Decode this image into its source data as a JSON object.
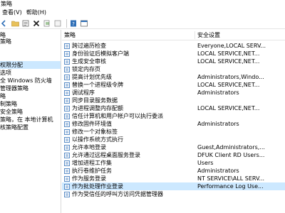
{
  "window": {
    "title": "策略"
  },
  "menubar": {
    "items": [
      "查看(V)",
      "帮助(H)"
    ]
  },
  "toolbar": {
    "icons": [
      "back-icon",
      "forward-icon",
      "folder-icon",
      "properties-icon",
      "delete-icon",
      "export-icon",
      "refresh-icon",
      "help-icon",
      "console-icon"
    ]
  },
  "tree": {
    "items": [
      {
        "label": "略"
      },
      {
        "label": "策略"
      },
      {
        "label": "权限分配"
      },
      {
        "label": "选项"
      },
      {
        "label": "全 Windows 防火墙"
      },
      {
        "label": "管理器策略"
      },
      {
        "label": "略"
      },
      {
        "label": "制策略"
      },
      {
        "label": "安全策略"
      },
      {
        "label": "策略，在 本地计算机"
      },
      {
        "label": "核策略配置"
      }
    ]
  },
  "table": {
    "columns": {
      "policy": "策略",
      "setting": "安全设置"
    },
    "rows": [
      {
        "policy": "跨过遍历检查",
        "setting": "Everyone,LOCAL SERV..."
      },
      {
        "policy": "身份验证后模拟客户端",
        "setting": "LOCAL SERVICE,NET..."
      },
      {
        "policy": "生成安全审核",
        "setting": "LOCAL SERVICE,NET..."
      },
      {
        "policy": "锁定内存页",
        "setting": ""
      },
      {
        "policy": "提高计划优先级",
        "setting": "Administrators,Windo..."
      },
      {
        "policy": "替换一个进程级令牌",
        "setting": "LOCAL SERVICE,NET..."
      },
      {
        "policy": "调试程序",
        "setting": "Administrators"
      },
      {
        "policy": "同步目录服务数据",
        "setting": ""
      },
      {
        "policy": "为进程调整内存配额",
        "setting": "LOCAL SERVICE,NET..."
      },
      {
        "policy": "信任计算机和用户帐户可以执行委派",
        "setting": ""
      },
      {
        "policy": "修改固件环境值",
        "setting": "Administrators"
      },
      {
        "policy": "修改一个对象标签",
        "setting": ""
      },
      {
        "policy": "以操作系统方式执行",
        "setting": ""
      },
      {
        "policy": "允许本地登录",
        "setting": "Guest,Administrators,..."
      },
      {
        "policy": "允许通过远程桌面服务登录",
        "setting": "DFUK Client RD Users..."
      },
      {
        "policy": "增加进程工作集",
        "setting": "Users"
      },
      {
        "policy": "执行卷维护任务",
        "setting": "Administrators"
      },
      {
        "policy": "作为服务登录",
        "setting": "NT SERVICE\\ALL SERV..."
      },
      {
        "policy": "作为批处理作业登录",
        "setting": "Performance Log Use..."
      },
      {
        "policy": "作为受信任的呼叫方访问凭据管理器",
        "setting": ""
      }
    ],
    "selected_index": 18
  },
  "colors": {
    "selection": "#cce8ff",
    "icon_blue": "#2f6fb7",
    "divider": "#e5e5e5"
  }
}
